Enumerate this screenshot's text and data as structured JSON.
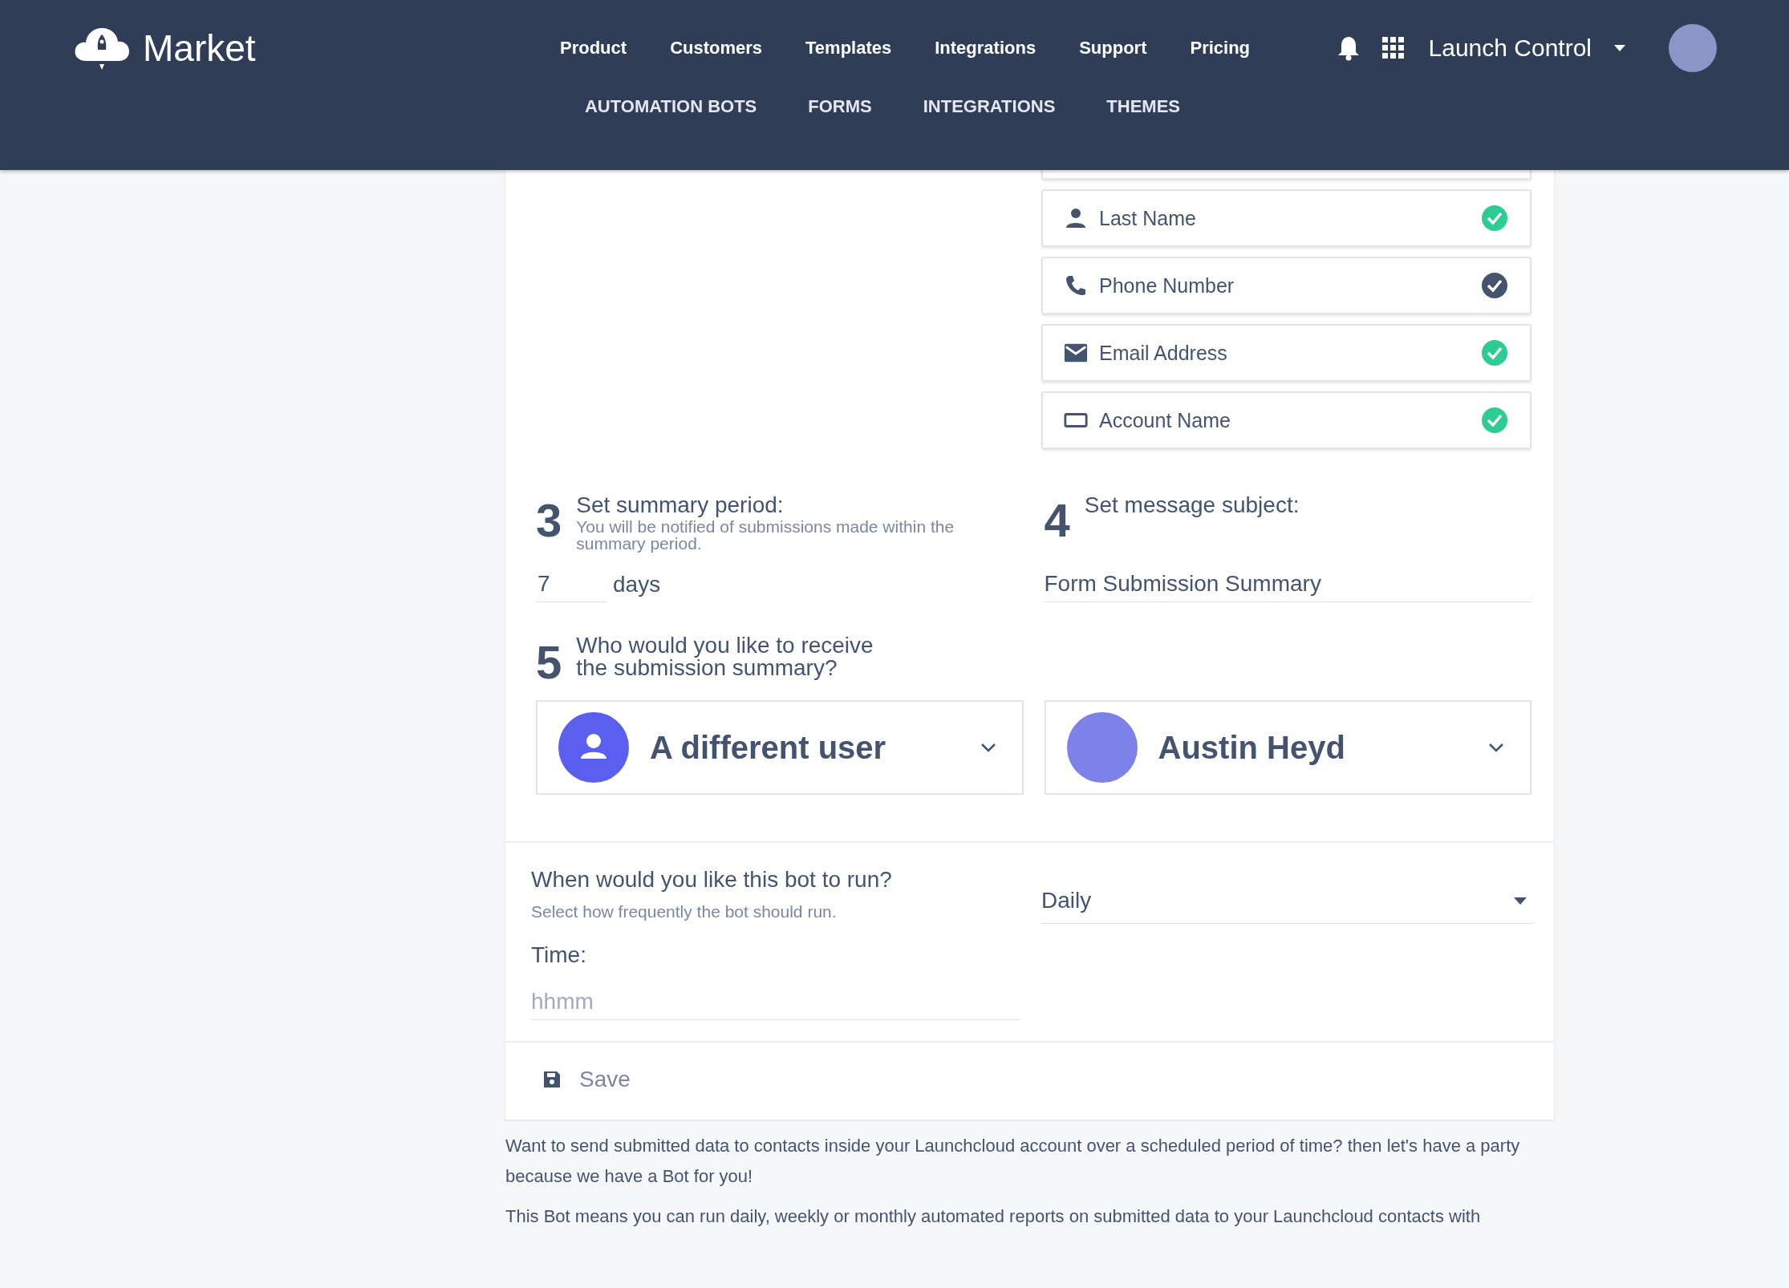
{
  "header": {
    "brand": "Market",
    "nav": [
      "Product",
      "Customers",
      "Templates",
      "Integrations",
      "Support",
      "Pricing"
    ],
    "account": "Launch Control"
  },
  "subnav": [
    "AUTOMATION BOTS",
    "FORMS",
    "INTEGRATIONS",
    "THEMES"
  ],
  "fields": [
    {
      "label": "Last Name",
      "kind": "person",
      "color": "#2dcc93"
    },
    {
      "label": "Phone Number",
      "kind": "phone",
      "color": "#44546f"
    },
    {
      "label": "Email Address",
      "kind": "email",
      "color": "#2dcc93"
    },
    {
      "label": "Account Name",
      "kind": "account",
      "color": "#2dcc93"
    }
  ],
  "step3": {
    "number": "3",
    "title": "Set summary period:",
    "hint": "You will be notified of submissions made within the summary period.",
    "value": "7",
    "unit": "days"
  },
  "step4": {
    "number": "4",
    "title": "Set message subject:",
    "value": "Form Submission Summary"
  },
  "step5": {
    "number": "5",
    "title": "Who would you like to receive the submission summary?",
    "recipients": [
      {
        "kind": "icon",
        "label": "A different user"
      },
      {
        "kind": "photo",
        "label": "Austin Heyd"
      }
    ]
  },
  "schedule": {
    "question": "When would you like this bot to run?",
    "hint": "Select how frequently the bot should run.",
    "frequency": "Daily",
    "time_label": "Time:",
    "time_placeholder": "hhmm"
  },
  "save": "Save",
  "description": [
    "Want to send submitted data to contacts inside your Launchcloud account over a scheduled period of time? then let's have a party because we have a Bot for you!",
    "This Bot means you can run daily, weekly or monthly automated reports on submitted data to your Launchcloud contacts with"
  ]
}
